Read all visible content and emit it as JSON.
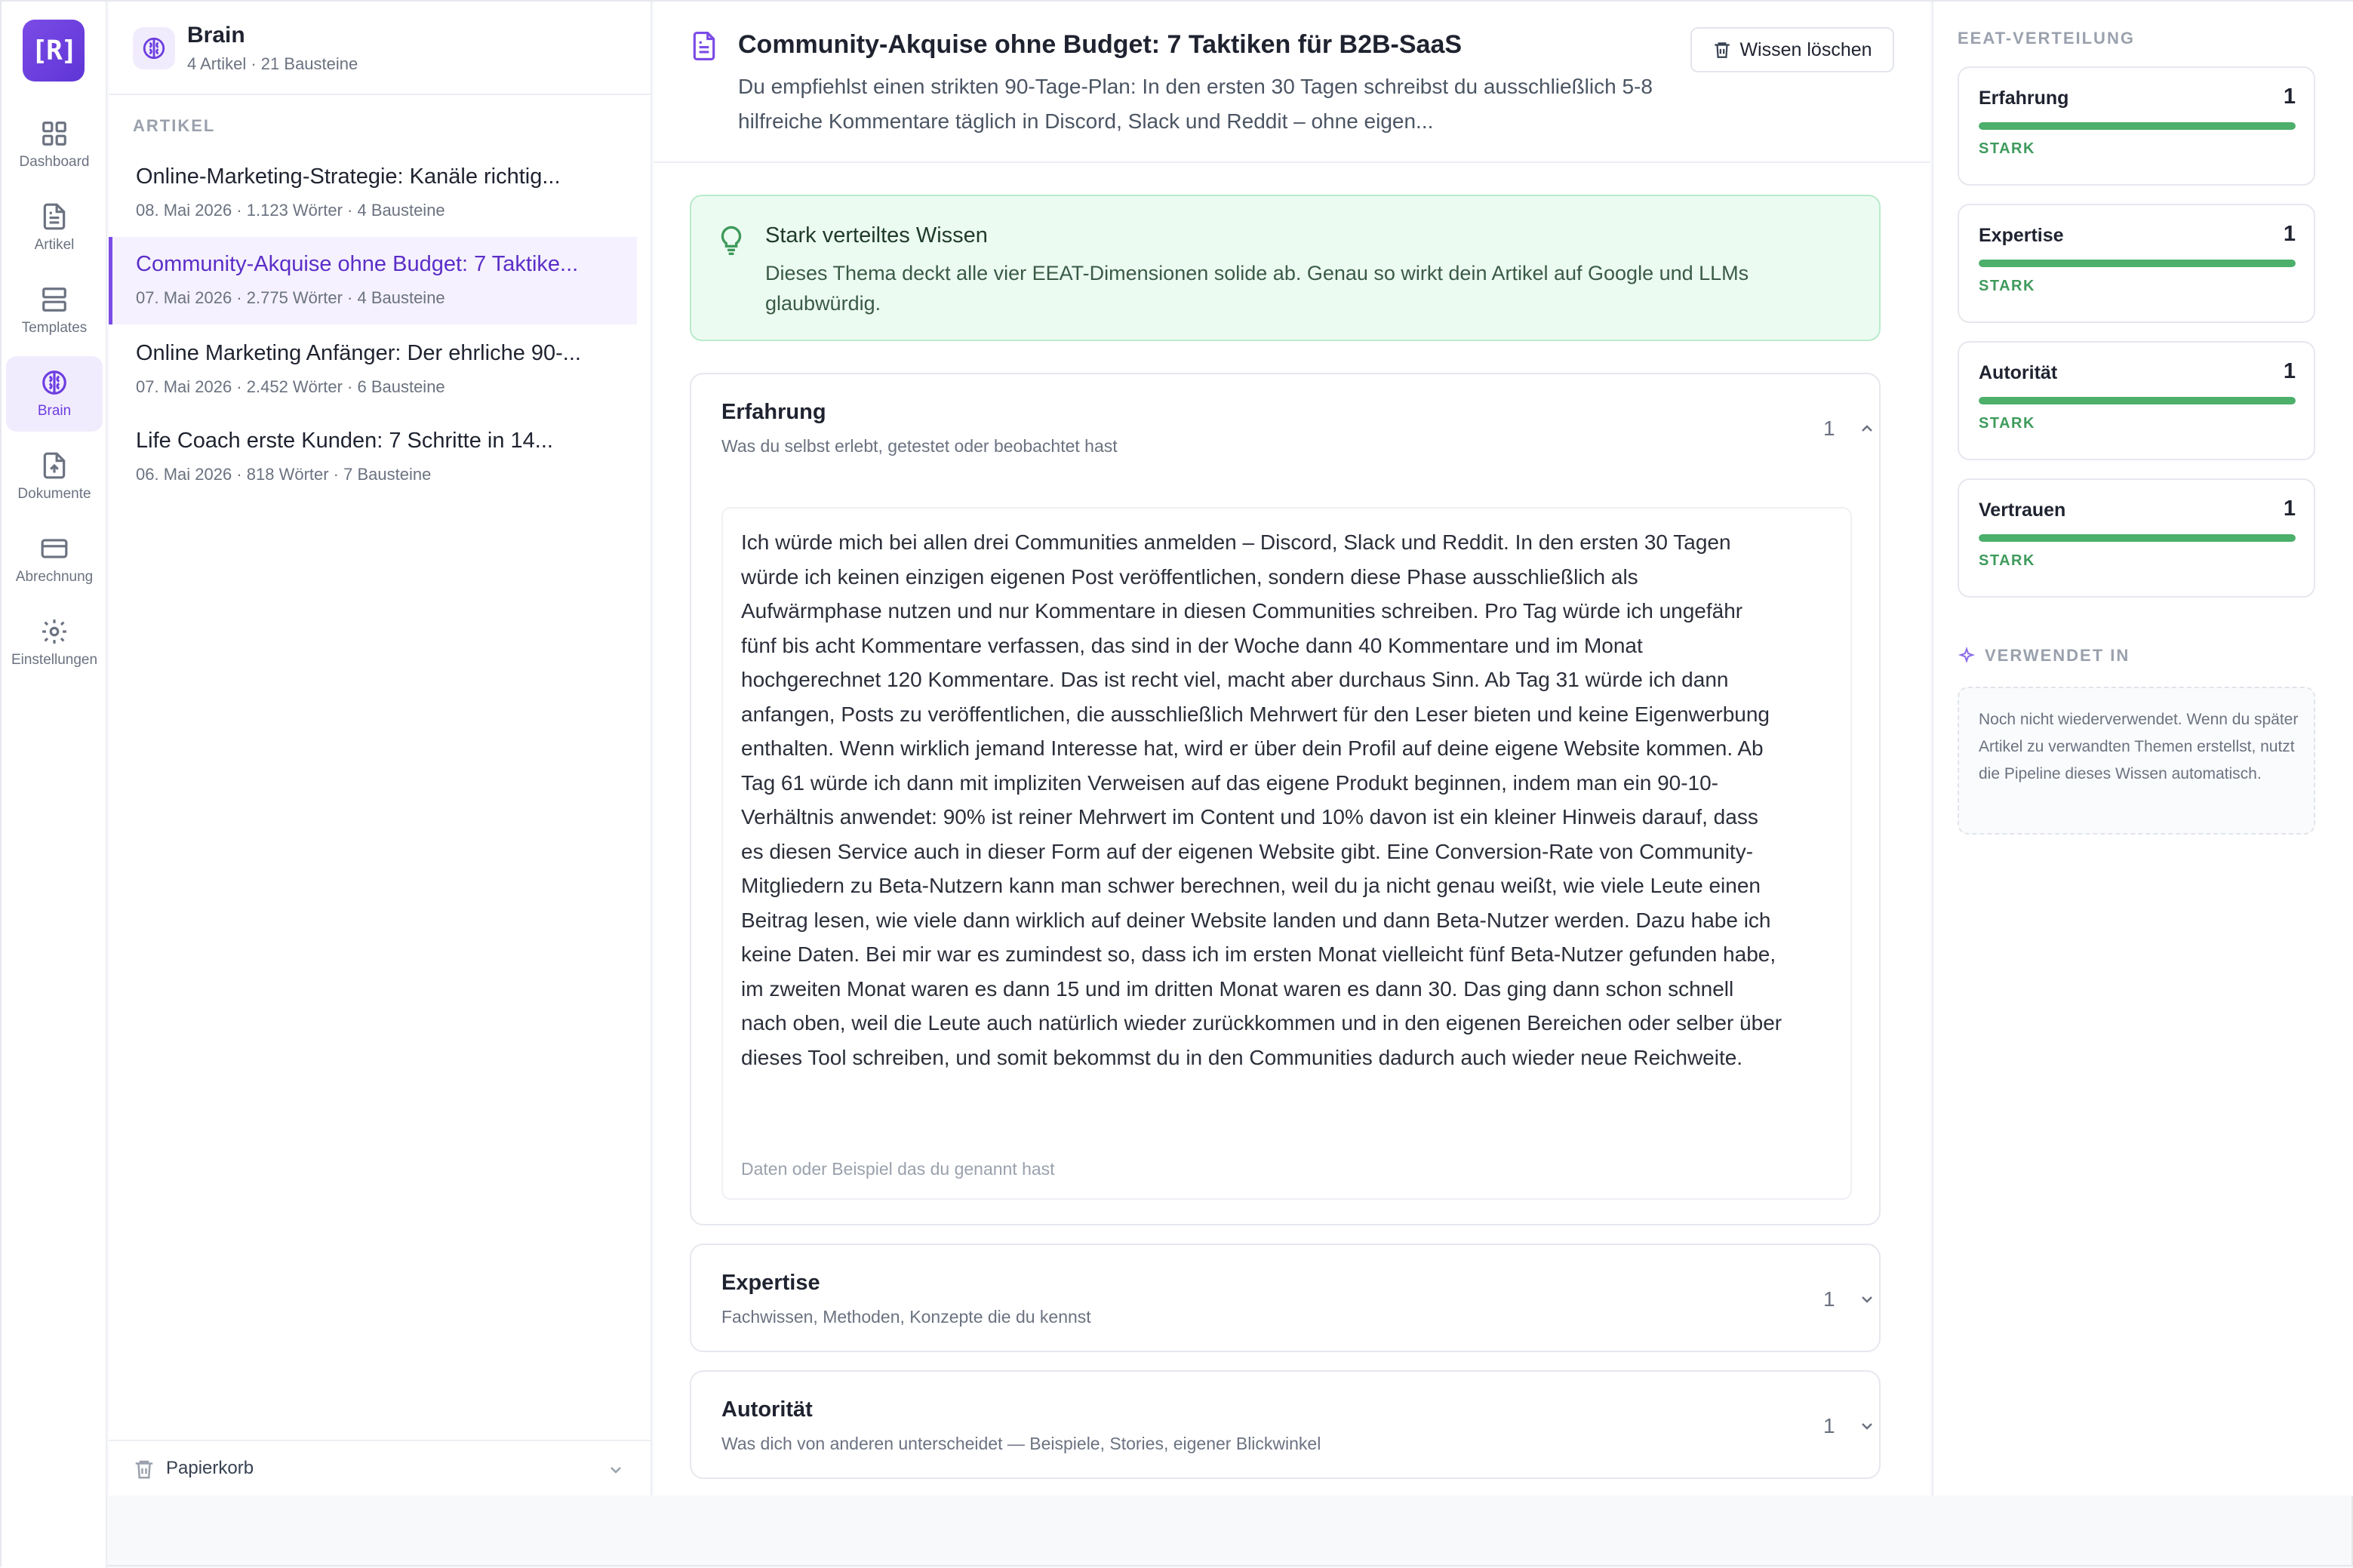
{
  "nav": {
    "logo": "[R]",
    "items": [
      {
        "label": "Dashboard",
        "icon": "grid-icon"
      },
      {
        "label": "Artikel",
        "icon": "file-text-icon"
      },
      {
        "label": "Templates",
        "icon": "layout-icon"
      },
      {
        "label": "Brain",
        "icon": "brain-icon",
        "active": true
      },
      {
        "label": "Dokumente",
        "icon": "file-upload-icon"
      },
      {
        "label": "Abrechnung",
        "icon": "credit-card-icon"
      },
      {
        "label": "Einstellungen",
        "icon": "gear-icon"
      }
    ]
  },
  "brain": {
    "title": "Brain",
    "subtitle": "4 Artikel · 21 Bausteine",
    "section_label": "ARTIKEL",
    "articles": [
      {
        "title": "Online-Marketing-Strategie: Kanäle richtig...",
        "meta": "08. Mai 2026 · 1.123 Wörter · 4 Bausteine"
      },
      {
        "title": "Community-Akquise ohne Budget: 7 Taktike...",
        "meta": "07. Mai 2026 · 2.775 Wörter · 4 Bausteine",
        "active": true
      },
      {
        "title": "Online Marketing Anfänger: Der ehrliche 90-...",
        "meta": "07. Mai 2026 · 2.452 Wörter · 6 Bausteine"
      },
      {
        "title": "Life Coach erste Kunden: 7 Schritte in 14...",
        "meta": "06. Mai 2026 · 818 Wörter · 7 Bausteine"
      }
    ],
    "trash_label": "Papierkorb"
  },
  "main": {
    "title": "Community-Akquise ohne Budget: 7 Taktiken für B2B-SaaS",
    "description": "Du empfiehlst einen strikten 90-Tage-Plan: In den ersten 30 Tagen schreibst du ausschließlich 5-8 hilfreiche Kommentare täglich in Discord, Slack und Reddit – ohne eigen...",
    "delete_label": "Wissen löschen",
    "callout": {
      "title": "Stark verteiltes Wissen",
      "text": "Dieses Thema deckt alle vier EEAT-Dimensionen solide ab. Genau so wirkt dein Artikel auf Google und LLMs glaubwürdig."
    },
    "sections": [
      {
        "name": "Erfahrung",
        "hint": "Was du selbst erlebt, getestet oder beobachtet hast",
        "count": "1",
        "expanded": true,
        "body": "Ich würde mich bei allen drei Communities anmelden – Discord, Slack und Reddit. In den ersten 30 Tagen würde ich keinen einzigen eigenen Post veröffentlichen, sondern diese Phase ausschließlich als Aufwärmphase nutzen und nur Kommentare in diesen Communities schreiben. Pro Tag würde ich ungefähr fünf bis acht Kommentare verfassen, das sind in der Woche dann 40 Kommentare und im Monat hochgerechnet 120 Kommentare. Das ist recht viel, macht aber durchaus Sinn. Ab Tag 31 würde ich dann anfangen, Posts zu veröffentlichen, die ausschließlich Mehrwert für den Leser bieten und keine Eigenwerbung enthalten. Wenn wirklich jemand Interesse hat, wird er über dein Profil auf deine eigene Website kommen. Ab Tag 61 würde ich dann mit impliziten Verweisen auf das eigene Produkt beginnen, indem man ein 90-10-Verhältnis anwendet: 90% ist reiner Mehrwert im Content und 10% davon ist ein kleiner Hinweis darauf, dass es diesen Service auch in dieser Form auf der eigenen Website gibt. Eine Conversion-Rate von Community-Mitgliedern zu Beta-Nutzern kann man schwer berechnen, weil du ja nicht genau weißt, wie viele Leute einen Beitrag lesen, wie viele dann wirklich auf deiner Website landen und dann Beta-Nutzer werden. Dazu habe ich keine Daten. Bei mir war es zumindest so, dass ich im ersten Monat vielleicht fünf Beta-Nutzer gefunden habe, im zweiten Monat waren es dann 15 und im dritten Monat waren es dann 30. Das ging dann schon schnell nach oben, weil die Leute auch natürlich wieder zurückkommen und in den eigenen Bereichen oder selber über dieses Tool schreiben, und somit bekommst du in den Communities dadurch auch wieder neue Reichweite.",
        "footer": "Daten oder Beispiel das du genannt hast"
      },
      {
        "name": "Expertise",
        "hint": "Fachwissen, Methoden, Konzepte die du kennst",
        "count": "1",
        "expanded": false
      },
      {
        "name": "Autorität",
        "hint": "Was dich von anderen unterscheidet — Beispiele, Stories, eigener Blickwinkel",
        "count": "1",
        "expanded": false
      }
    ]
  },
  "eeat_panel": {
    "label": "EEAT-VERTEILUNG",
    "items": [
      {
        "name": "Erfahrung",
        "value": "1",
        "status": "STARK",
        "fill": 1.0
      },
      {
        "name": "Expertise",
        "value": "1",
        "status": "STARK",
        "fill": 1.0
      },
      {
        "name": "Autorität",
        "value": "1",
        "status": "STARK",
        "fill": 1.0
      },
      {
        "name": "Vertrauen",
        "value": "1",
        "status": "STARK",
        "fill": 1.0
      }
    ],
    "used_label": "VERWENDET IN",
    "used_text": "Noch nicht wiederverwendet. Wenn du später Artikel zu verwandten Themen erstellst, nutzt die Pipeline dieses Wissen automatisch.",
    "bar_color": "#4caf6a"
  }
}
